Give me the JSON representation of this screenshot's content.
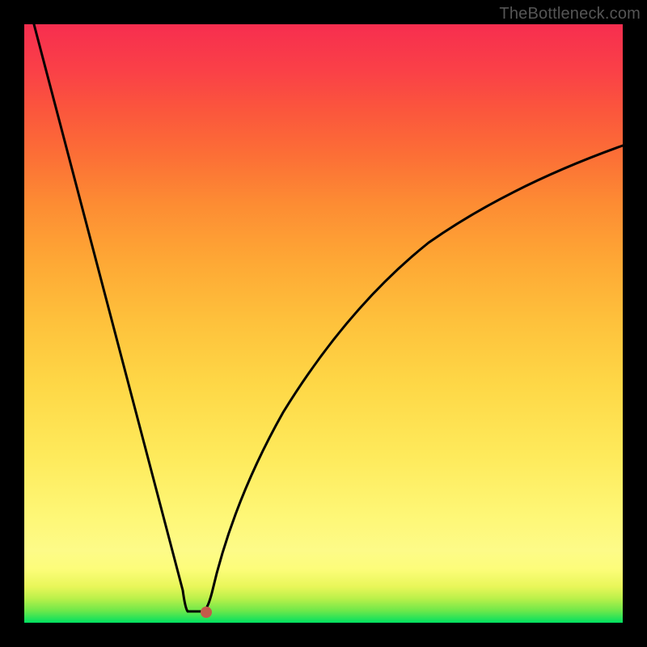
{
  "watermark": "TheBottleneck.com",
  "chart_data": {
    "type": "line",
    "title": "",
    "xlabel": "",
    "ylabel": "",
    "xlim": [
      0,
      100
    ],
    "ylim": [
      0,
      100
    ],
    "grid": false,
    "legend": false,
    "series": [
      {
        "name": "bottleneck-curve",
        "x": [
          0,
          5,
          10,
          15,
          20,
          23,
          25,
          26,
          27,
          28,
          29,
          30,
          32,
          35,
          40,
          45,
          50,
          55,
          60,
          65,
          70,
          75,
          80,
          85,
          90,
          95,
          100
        ],
        "values": [
          100,
          82,
          64,
          46,
          28,
          17,
          10,
          6,
          3,
          1,
          0,
          0,
          4,
          13,
          26,
          37,
          46,
          53,
          59,
          64,
          68,
          71,
          74,
          76,
          78,
          79,
          80
        ]
      }
    ],
    "marker": {
      "x": 29,
      "y": 0
    },
    "colors": {
      "curve": "#000000",
      "marker": "#c45a4a",
      "bg_top": "#f72e4f",
      "bg_mid": "#fed746",
      "bg_bottom": "#00e060",
      "frame": "#000000"
    }
  }
}
